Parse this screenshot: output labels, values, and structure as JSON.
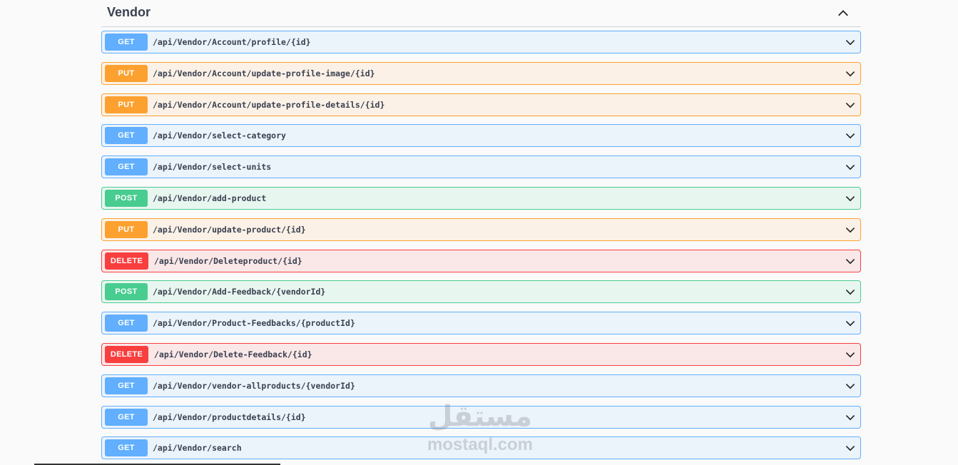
{
  "section": {
    "title": "Vendor",
    "toggle_icon": "chevron-up-icon"
  },
  "operations": [
    {
      "method": "GET",
      "path": "/api/Vendor/Account/profile/{id}"
    },
    {
      "method": "PUT",
      "path": "/api/Vendor/Account/update-profile-image/{id}"
    },
    {
      "method": "PUT",
      "path": "/api/Vendor/Account/update-profile-details/{id}"
    },
    {
      "method": "GET",
      "path": "/api/Vendor/select-category"
    },
    {
      "method": "GET",
      "path": "/api/Vendor/select-units"
    },
    {
      "method": "POST",
      "path": "/api/Vendor/add-product"
    },
    {
      "method": "PUT",
      "path": "/api/Vendor/update-product/{id}"
    },
    {
      "method": "DELETE",
      "path": "/api/Vendor/Deleteproduct/{id}"
    },
    {
      "method": "POST",
      "path": "/api/Vendor/Add-Feedback/{vendorId}"
    },
    {
      "method": "GET",
      "path": "/api/Vendor/Product-Feedbacks/{productId}"
    },
    {
      "method": "DELETE",
      "path": "/api/Vendor/Delete-Feedback/{id}"
    },
    {
      "method": "GET",
      "path": "/api/Vendor/vendor-allproducts/{vendorId}"
    },
    {
      "method": "GET",
      "path": "/api/Vendor/productdetails/{id}"
    },
    {
      "method": "GET",
      "path": "/api/Vendor/search"
    }
  ],
  "colors": {
    "get": "#61affe",
    "put": "#fca130",
    "post": "#49cc90",
    "delete": "#f93e3e"
  },
  "watermark": {
    "arabic": "مستقل",
    "latin": "mostaql.com"
  }
}
